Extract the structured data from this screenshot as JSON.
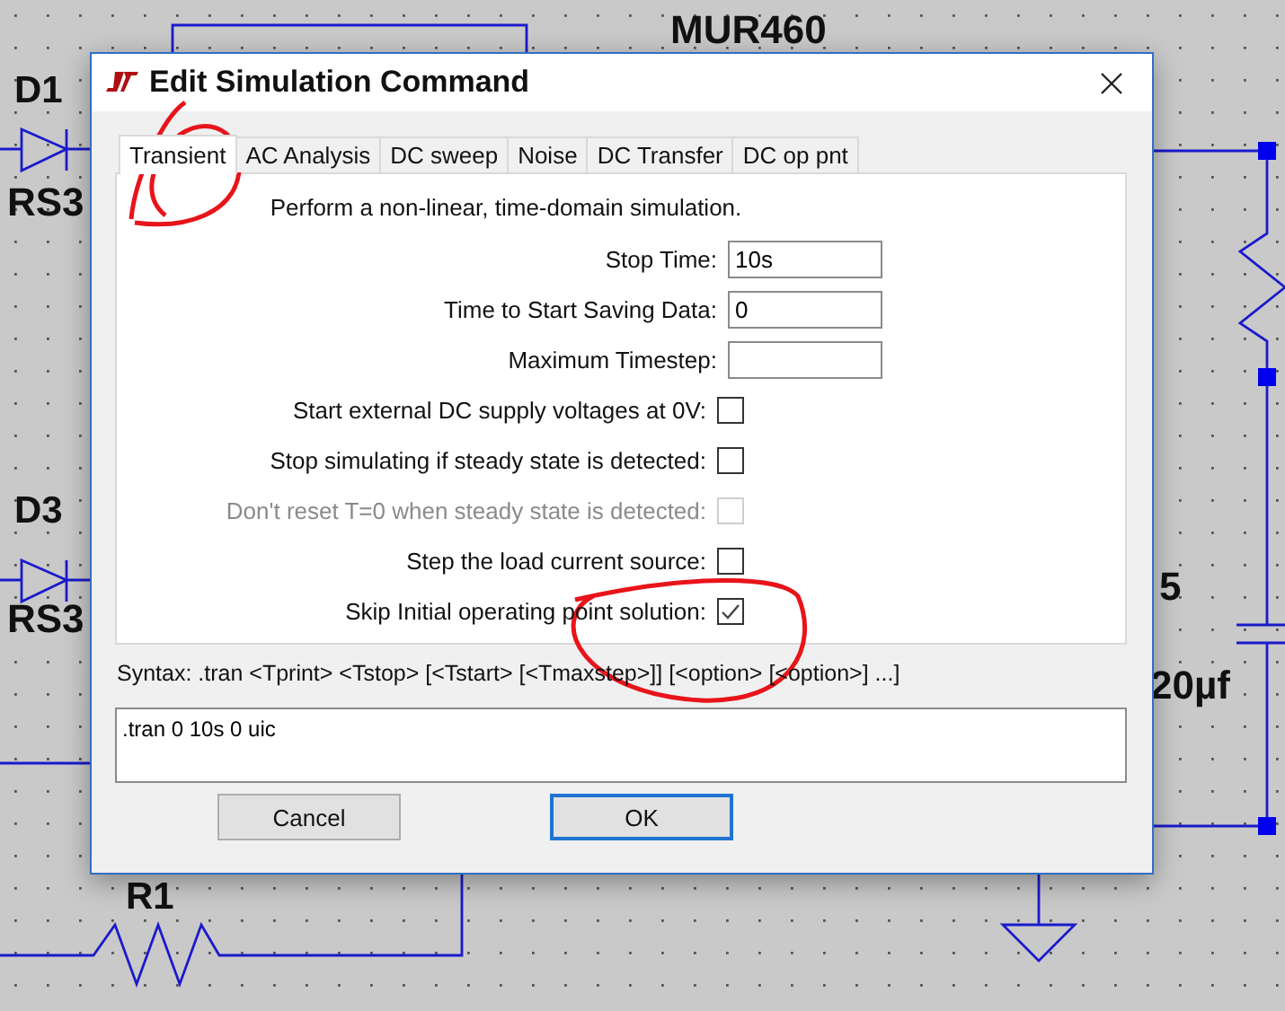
{
  "schematic": {
    "labels": [
      {
        "text": "MUR460"
      },
      {
        "text": "D1"
      },
      {
        "text": "RS3"
      },
      {
        "text": "D3"
      },
      {
        "text": "RS3"
      },
      {
        "text": "5"
      },
      {
        "text": "20µf"
      },
      {
        "text": "R1"
      }
    ]
  },
  "dialog": {
    "title": "Edit Simulation Command",
    "tabs": [
      {
        "label": "Transient",
        "selected": true
      },
      {
        "label": "AC Analysis",
        "selected": false
      },
      {
        "label": "DC sweep",
        "selected": false
      },
      {
        "label": "Noise",
        "selected": false
      },
      {
        "label": "DC Transfer",
        "selected": false
      },
      {
        "label": "DC op pnt",
        "selected": false
      }
    ],
    "description": "Perform a non-linear, time-domain simulation.",
    "fields": [
      {
        "label": "Stop Time:",
        "value": "10s"
      },
      {
        "label": "Time to Start Saving Data:",
        "value": "0"
      },
      {
        "label": "Maximum Timestep:"
      }
    ],
    "options": [
      {
        "label": "Start external DC supply voltages at 0V:",
        "checked": false,
        "disabled": false
      },
      {
        "label": "Stop simulating if steady state is detected:",
        "checked": false,
        "disabled": false
      },
      {
        "label": "Don't reset T=0 when steady state is detected:",
        "checked": false,
        "disabled": true
      },
      {
        "label": "Step the load current source:",
        "checked": false,
        "disabled": false
      },
      {
        "label": "Skip Initial operating point solution:",
        "checked": true,
        "disabled": false
      }
    ],
    "syntax": "Syntax:  .tran <Tprint> <Tstop> [<Tstart> [<Tmaxstep>]] [<option> [<option>] ...]",
    "command": ".tran 0 10s 0 uic",
    "buttons": [
      {
        "label": "Cancel",
        "default": false
      },
      {
        "label": "OK",
        "default": true
      }
    ]
  }
}
